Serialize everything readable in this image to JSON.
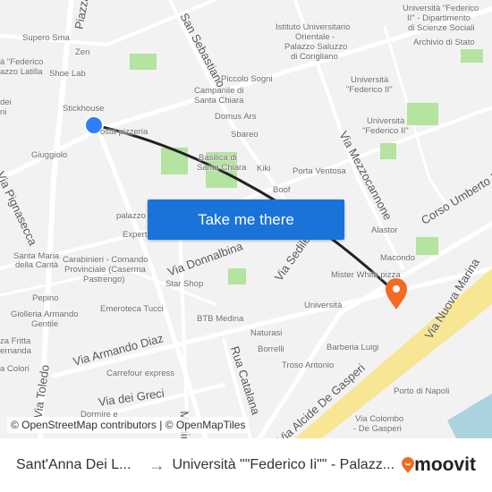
{
  "map": {
    "labels": [
      "Supero Sma",
      "Zen",
      "à \"Federico",
      "azzo Latilla",
      "Shoe Lab",
      "Stickhouse",
      "dei",
      "ni",
      "Giuggiolo",
      "osta pizzeria",
      "Piccolo Sogni",
      "Campanile di",
      "Santa Chiara",
      "Domus Ars",
      "Sbareo",
      "Basilica di",
      "Santa Chiara",
      "Kiki",
      "Porta Ventosa",
      "Boof",
      "Istituto Universitario",
      "Orientale -",
      "Palazzo Saluzzo",
      "di Corigliano",
      "Università \"Federico",
      "II\" - Dipartimento",
      "di Scienze Sociali",
      "Archivio di Stato",
      "Università",
      "\"Federico II\"",
      "Università",
      "\"Federico II\"",
      "Alastor",
      "Macondo",
      "Mister White pizza",
      "Università",
      "palazzo C",
      "Expert",
      "Santa Maria",
      "della Carità",
      "Carabinieri - Comando",
      "Provinciale (Caserma",
      "Pastrengo)",
      "Star Shop",
      "Pepino",
      "Giolleria Armando",
      "Gentile",
      "Emeroteca Tucci",
      "BTB Medina",
      "Naturasi",
      "Borrelli",
      "za Fritta",
      "ernanda",
      "a Colori",
      "Carrefour express",
      "Barberia Luigi",
      "Troso Antonio",
      "Porto di Napoli",
      "Via Colombo",
      "- De Gasperi",
      "Dormire e"
    ],
    "streets": [
      "Piazza",
      "San Sebastiano",
      "Via Pignasecca",
      "Via Mezzocannone",
      "Corso Umberto I",
      "Via Sedile di Porto",
      "Via Donnalbina",
      "Via Armando Diaz",
      "Via Toledo",
      "Via dei Greci",
      "Rua Catalana",
      "Via Alcide De Gasperi",
      "Via Nuova Marina",
      "Medina"
    ],
    "origin_color": "#2d7ff9",
    "destination_color": "#f26b21",
    "route_color": "#222222"
  },
  "cta": {
    "label": "Take me there"
  },
  "attribution": "© OpenStreetMap contributors | © OpenMapTiles",
  "footer": {
    "origin": "Sant'Anna Dei L...",
    "arrow": "→",
    "destination": "Università \"\"Federico Ii\"\" - Palazz...",
    "brand": "moovit"
  }
}
